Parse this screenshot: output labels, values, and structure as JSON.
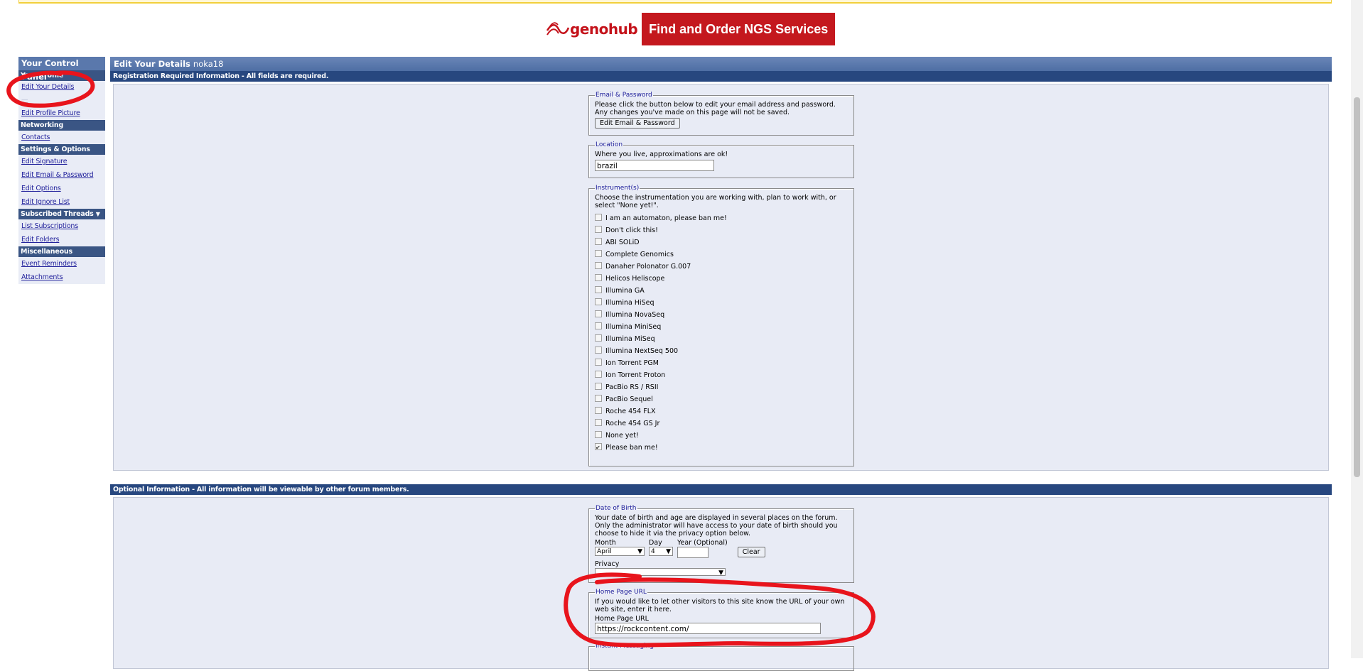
{
  "banner": {
    "logo_text": "genohub",
    "button_label": "Find and Order NGS Services"
  },
  "sidebar": {
    "title": "Your Control Panel",
    "sections": [
      {
        "heading": "Your Profile",
        "links": [
          "Edit Your Details",
          "Edit Profile Picture"
        ]
      },
      {
        "heading": "Networking",
        "links": [
          "Contacts"
        ]
      },
      {
        "heading": "Settings & Options",
        "links": [
          "Edit Signature",
          "Edit Email & Password",
          "Edit Options",
          "Edit Ignore List"
        ]
      },
      {
        "heading": "Subscribed Threads",
        "links": [
          "List Subscriptions",
          "Edit Folders"
        ]
      },
      {
        "heading": "Miscellaneous",
        "links": [
          "Event Reminders",
          "Attachments"
        ]
      }
    ]
  },
  "main": {
    "title": "Edit Your Details",
    "username": "noka18",
    "required_header": "Registration Required Information - All fields are required.",
    "optional_header": "Optional Information - All information will be viewable by other forum members."
  },
  "email_password": {
    "legend": "Email & Password",
    "text": "Please click the button below to edit your email address and password. Any changes you've made on this page will not be saved.",
    "button": "Edit Email & Password"
  },
  "location": {
    "legend": "Location",
    "text": "Where you live, approximations are ok!",
    "value": "brazil"
  },
  "instruments": {
    "legend": "Instrument(s)",
    "text": "Choose the instrumentation you are working with, plan to work with, or select \"None yet!\".",
    "options": [
      {
        "label": "I am an automaton, please ban me!",
        "checked": false
      },
      {
        "label": "Don't click this!",
        "checked": false
      },
      {
        "label": "ABI SOLiD",
        "checked": false
      },
      {
        "label": "Complete Genomics",
        "checked": false
      },
      {
        "label": "Danaher Polonator G.007",
        "checked": false
      },
      {
        "label": "Helicos Heliscope",
        "checked": false
      },
      {
        "label": "Illumina GA",
        "checked": false
      },
      {
        "label": "Illumina HiSeq",
        "checked": false
      },
      {
        "label": "Illumina NovaSeq",
        "checked": false
      },
      {
        "label": "Illumina MiniSeq",
        "checked": false
      },
      {
        "label": "Illumina MiSeq",
        "checked": false
      },
      {
        "label": "Illumina NextSeq 500",
        "checked": false
      },
      {
        "label": "Ion Torrent PGM",
        "checked": false
      },
      {
        "label": "Ion Torrent Proton",
        "checked": false
      },
      {
        "label": "PacBio RS / RSII",
        "checked": false
      },
      {
        "label": "PacBio Sequel",
        "checked": false
      },
      {
        "label": "Roche 454 FLX",
        "checked": false
      },
      {
        "label": "Roche 454 GS Jr",
        "checked": false
      },
      {
        "label": "None yet!",
        "checked": false
      },
      {
        "label": "Please ban me!",
        "checked": true
      }
    ]
  },
  "dob": {
    "legend": "Date of Birth",
    "text": "Your date of birth and age are displayed in several places on the forum. Only the administrator will have access to your date of birth should you choose to hide it via the privacy option below.",
    "month_label": "Month",
    "month_value": "April",
    "day_label": "Day",
    "day_value": "4",
    "year_label": "Year (Optional)",
    "clear_button": "Clear",
    "privacy_label": "Privacy"
  },
  "homepage": {
    "legend": "Home Page URL",
    "text": "If you would like to let other visitors to this site know the URL of your own web site, enter it here.",
    "field_label": "Home Page URL",
    "value": "https://rockcontent.com/"
  },
  "instant_messaging": {
    "legend": "Instant Messaging"
  },
  "colors": {
    "accent_red": "#c4181e",
    "header_blue": "#27477f",
    "annotation_red": "#e8141c"
  }
}
